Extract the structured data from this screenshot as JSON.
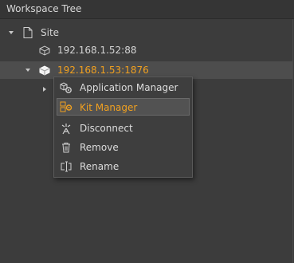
{
  "panel": {
    "title": "Workspace Tree"
  },
  "tree": {
    "site": {
      "label": "Site",
      "icon": "document-icon"
    },
    "device1": {
      "label": "192.168.1.52:88",
      "icon": "device-icon"
    },
    "device2": {
      "label": "192.168.1.53:1876",
      "icon": "device-icon",
      "selected": true
    }
  },
  "context_menu": {
    "items": [
      {
        "label": "Application Manager",
        "icon": "application-manager-icon"
      },
      {
        "label": "Kit Manager",
        "icon": "kit-manager-icon",
        "highlighted": true
      },
      {
        "label": "Disconnect",
        "icon": "disconnect-icon"
      },
      {
        "label": "Remove",
        "icon": "trash-icon"
      },
      {
        "label": "Rename",
        "icon": "rename-icon"
      }
    ]
  },
  "colors": {
    "accent": "#f0a020",
    "background": "#3c3c3c"
  }
}
